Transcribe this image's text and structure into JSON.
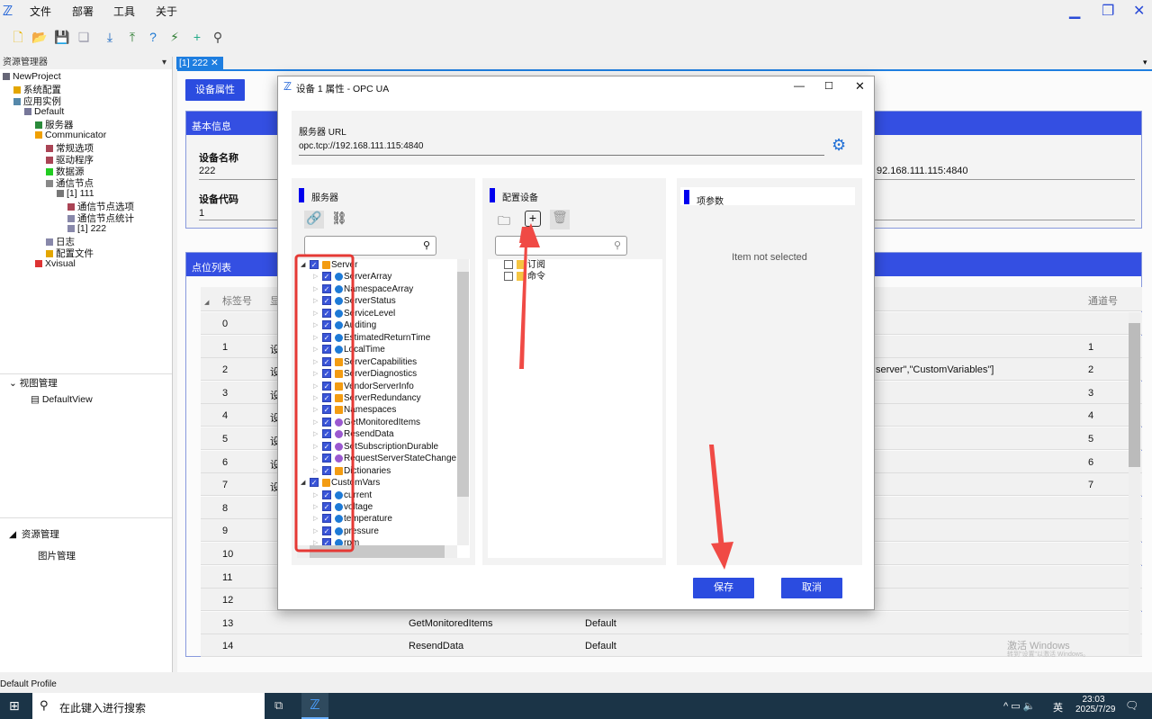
{
  "app": {
    "logo": "X-logo",
    "menu": [
      "文件",
      "部署",
      "工具",
      "关于"
    ]
  },
  "toolbar": {
    "icons": [
      "new-file-icon",
      "open-folder-icon",
      "save-icon",
      "save-all-icon",
      "download-icon",
      "upload-icon",
      "help-icon",
      "connect-icon",
      "add-device-icon",
      "wand-icon"
    ]
  },
  "explorer": {
    "title": "资源管理器",
    "tree": [
      {
        "label": "NewProject",
        "depth": 0
      },
      {
        "label": "系统配置",
        "depth": 1
      },
      {
        "label": "应用实例",
        "depth": 1
      },
      {
        "label": "Default",
        "depth": 2
      },
      {
        "label": "服务器",
        "depth": 3
      },
      {
        "label": "Communicator",
        "depth": 3
      },
      {
        "label": "常规选项",
        "depth": 4
      },
      {
        "label": "驱动程序",
        "depth": 4
      },
      {
        "label": "数据源",
        "depth": 4
      },
      {
        "label": "通信节点",
        "depth": 4
      },
      {
        "label": "[1] 111",
        "depth": 5
      },
      {
        "label": "通信节点选项",
        "depth": 6
      },
      {
        "label": "通信节点统计",
        "depth": 6
      },
      {
        "label": "[1] 222",
        "depth": 6
      },
      {
        "label": "日志",
        "depth": 4
      },
      {
        "label": "配置文件",
        "depth": 4
      },
      {
        "label": "Xvisual",
        "depth": 3
      }
    ]
  },
  "view_mgmt": {
    "title": "视图管理",
    "item": "DefaultView"
  },
  "res_mgmt": {
    "title": "资源管理",
    "item": "图片管理"
  },
  "tab": {
    "label": "[1] 222"
  },
  "main": {
    "device_props_btn": "设备属性",
    "basic_title": "基本信息",
    "device_name_label": "设备名称",
    "device_name": "222",
    "device_code_label": "设备代码",
    "device_code": "1",
    "url_partial": "92.168.111.115:4840",
    "points_title": "点位列表",
    "col_tag": "标签号",
    "col_name_partial": "显",
    "col_channel": "通道号",
    "rows": [
      {
        "tag": "0",
        "name": "",
        "group": "",
        "extra": "",
        "ch": ""
      },
      {
        "tag": "1",
        "name": "设",
        "group": "",
        "extra": "",
        "ch": "1"
      },
      {
        "tag": "2",
        "name": "设",
        "group": "",
        "extra": "server\",\"CustomVariables\"]",
        "ch": "2"
      },
      {
        "tag": "3",
        "name": "设",
        "group": "",
        "extra": "",
        "ch": "3"
      },
      {
        "tag": "4",
        "name": "设",
        "group": "",
        "extra": "",
        "ch": "4"
      },
      {
        "tag": "5",
        "name": "设",
        "group": "",
        "extra": "",
        "ch": "5"
      },
      {
        "tag": "6",
        "name": "设",
        "group": "",
        "extra": "",
        "ch": "6"
      },
      {
        "tag": "7",
        "name": "设",
        "group": "",
        "extra": "",
        "ch": "7"
      },
      {
        "tag": "8",
        "name": "",
        "group": "",
        "extra": "",
        "ch": ""
      },
      {
        "tag": "9",
        "name": "",
        "group": "",
        "extra": "",
        "ch": ""
      },
      {
        "tag": "10",
        "name": "",
        "group": "",
        "extra": "",
        "ch": ""
      },
      {
        "tag": "11",
        "name": "",
        "group": "",
        "extra": "",
        "ch": ""
      },
      {
        "tag": "12",
        "name": "",
        "group": "",
        "extra": "",
        "ch": ""
      },
      {
        "tag": "13",
        "name": "GetMonitoredItems",
        "group": "Default",
        "extra": "",
        "ch": ""
      },
      {
        "tag": "14",
        "name": "ResendData",
        "group": "Default",
        "extra": "",
        "ch": ""
      }
    ]
  },
  "dialog": {
    "title": "设备 1 属性 - OPC UA",
    "url_label": "服务器 URL",
    "url": "opc.tcp://192.168.111.115:4840",
    "server_title": "服务器",
    "config_title": "配置设备",
    "params_title": "项参数",
    "params_empty": "Item not selected",
    "server_tree": [
      {
        "label": "Server",
        "level": 0,
        "icon": "object"
      },
      {
        "label": "ServerArray",
        "level": 1,
        "icon": "variable"
      },
      {
        "label": "NamespaceArray",
        "level": 1,
        "icon": "variable"
      },
      {
        "label": "ServerStatus",
        "level": 1,
        "icon": "variable"
      },
      {
        "label": "ServiceLevel",
        "level": 1,
        "icon": "variable"
      },
      {
        "label": "Auditing",
        "level": 1,
        "icon": "variable"
      },
      {
        "label": "EstimatedReturnTime",
        "level": 1,
        "icon": "variable"
      },
      {
        "label": "LocalTime",
        "level": 1,
        "icon": "variable"
      },
      {
        "label": "ServerCapabilities",
        "level": 1,
        "icon": "object"
      },
      {
        "label": "ServerDiagnostics",
        "level": 1,
        "icon": "object"
      },
      {
        "label": "VendorServerInfo",
        "level": 1,
        "icon": "object"
      },
      {
        "label": "ServerRedundancy",
        "level": 1,
        "icon": "object"
      },
      {
        "label": "Namespaces",
        "level": 1,
        "icon": "object"
      },
      {
        "label": "GetMonitoredItems",
        "level": 1,
        "icon": "method"
      },
      {
        "label": "ResendData",
        "level": 1,
        "icon": "method"
      },
      {
        "label": "SetSubscriptionDurable",
        "level": 1,
        "icon": "method"
      },
      {
        "label": "RequestServerStateChange",
        "level": 1,
        "icon": "method"
      },
      {
        "label": "Dictionaries",
        "level": 1,
        "icon": "object"
      },
      {
        "label": "CustomVars",
        "level": 0,
        "icon": "object"
      },
      {
        "label": "current",
        "level": 1,
        "icon": "variable"
      },
      {
        "label": "voltage",
        "level": 1,
        "icon": "variable"
      },
      {
        "label": "temperature",
        "level": 1,
        "icon": "variable"
      },
      {
        "label": "pressure",
        "level": 1,
        "icon": "variable"
      },
      {
        "label": "rpm",
        "level": 1,
        "icon": "variable"
      }
    ],
    "config_tree": [
      {
        "label": "订阅"
      },
      {
        "label": "命令"
      }
    ],
    "save": "保存",
    "cancel": "取消"
  },
  "status": {
    "profile": "Default Profile"
  },
  "watermark": {
    "line1": "激活 Windows",
    "line2": "转到\"设置\"以激活 Windows。"
  },
  "taskbar": {
    "search": "在此键入进行搜索",
    "time": "23:03",
    "date": "2025/7/29",
    "ime": "英"
  },
  "colors": {
    "accent": "#344fe2",
    "highlight": "#e53935"
  }
}
